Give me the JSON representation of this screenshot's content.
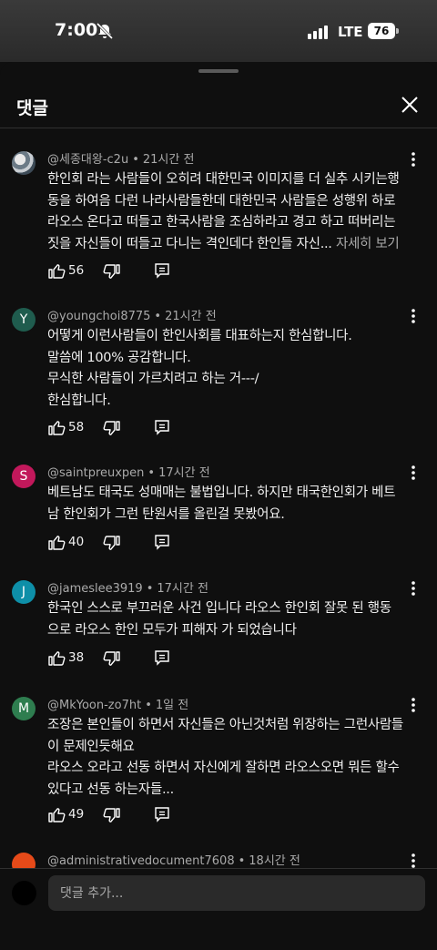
{
  "status_bar": {
    "time": "7:00",
    "network": "LTE",
    "battery": "76"
  },
  "sheet": {
    "title": "댓글",
    "close_icon": "close-icon"
  },
  "comments": [
    {
      "author": "@세종대왕-c2u",
      "time": "21시간 전",
      "avatar_letter": "",
      "avatar_color": "",
      "lines": [
        "한인회 라는 사람들이 오히려 대한민국 이미지를 더 실추 시키는행",
        "동을 하여음 다런 나라사람들한데 대한민국 사람들은 성행위 하로",
        "라오스 온다고 떠들고 한국사람을 조심하라고 경고 하고 떠버리는"
      ],
      "last_line": "짓을 자신들이 떠들고 다니는 격인데다 한인들 자신...",
      "more": "자세히 보기",
      "likes": "56"
    },
    {
      "author": "@youngchoi8775",
      "time": "21시간 전",
      "avatar_letter": "Y",
      "avatar_color": "#1f5c4e",
      "lines": [
        "어떻게 이런사람들이 한인사회를 대표하는지 한심합니다.",
        "말씀에 100% 공감합니다.",
        "무식한 사람들이 가르치려고 하는 거---/",
        "한심합니다."
      ],
      "likes": "58"
    },
    {
      "author": "@saintpreuxpen",
      "time": "17시간 전",
      "avatar_letter": "S",
      "avatar_color": "#c2185b",
      "lines": [
        "베트남도 태국도 성매매는 불법입니다. 하지만 태국한인회가 베트",
        "남 한인회가 그런 탄원서를 올린걸 못봤어요."
      ],
      "likes": "40"
    },
    {
      "author": "@jameslee3919",
      "time": "17시간 전",
      "avatar_letter": "J",
      "avatar_color": "#0e8fa8",
      "lines": [
        "한국인 스스로 부끄러운 사건 입니다  라오스 한인회  잘못 된 행동",
        "으로 라오스  한인 모두가  피해자 가 되었습니다"
      ],
      "likes": "38"
    },
    {
      "author": "@MkYoon-zo7ht",
      "time": "1일 전",
      "avatar_letter": "M",
      "avatar_color": "#2e7d4f",
      "lines": [
        "조장은 본인들이 하면서 자신들은 아닌것처럼 위장하는 그런사람들",
        "이 문제인듯해요",
        "라오스 오라고 선동 하면서 자신에게 잘하면 라오스오면 뭐든 할수",
        "있다고 선동 하는자들..."
      ],
      "likes": "49"
    },
    {
      "author": "@administrativedocument7608",
      "time": "18시간 전",
      "avatar_letter": "",
      "avatar_color": "#e64a19",
      "lines": [],
      "likes": ""
    }
  ],
  "footer": {
    "placeholder": "댓글 추가..."
  }
}
